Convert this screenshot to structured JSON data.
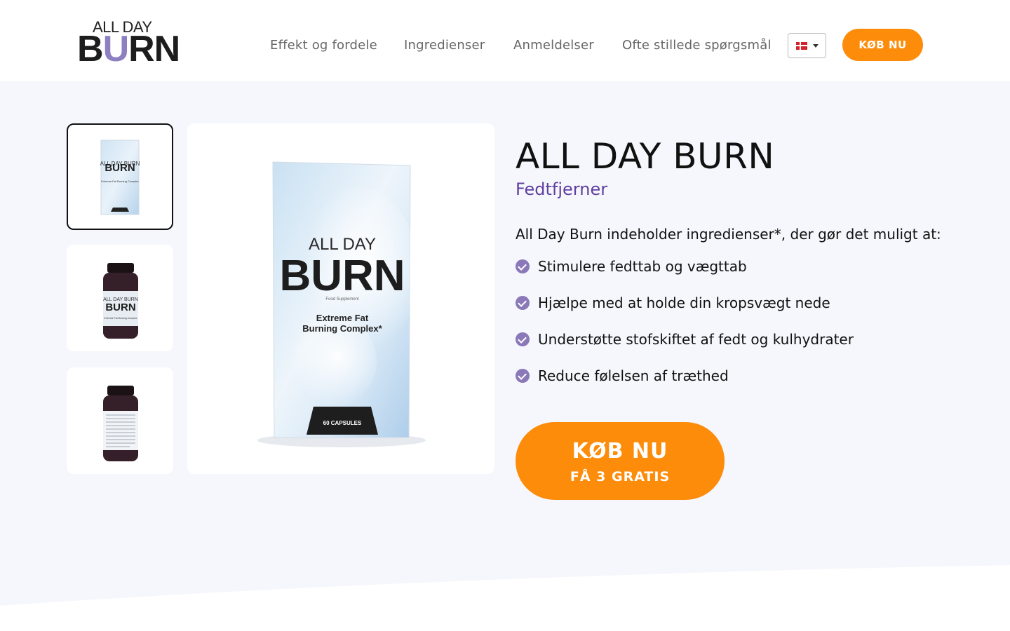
{
  "header": {
    "logo": {
      "top_text": "ALL DAY",
      "main_text_a": "B",
      "main_text_u": "U",
      "main_text_b": "RN"
    },
    "nav": [
      {
        "label": "Effekt og fordele"
      },
      {
        "label": "Ingredienser"
      },
      {
        "label": "Anmeldelser"
      },
      {
        "label": "Ofte stillede spørgsmål"
      }
    ],
    "language": {
      "flag": "denmark-flag-icon",
      "selected": "DK"
    },
    "buy_label": "KØB NU"
  },
  "gallery": {
    "thumbnails": [
      {
        "name": "product-box-thumbnail",
        "label": "ALL DAY BURN",
        "subtext": "Extreme Fat Burning Complex",
        "active": true
      },
      {
        "name": "product-bottle-front-thumbnail",
        "label": "ALL DAY BURN",
        "subtext": "Extreme Fat Burning Complex",
        "active": false
      },
      {
        "name": "product-bottle-back-thumbnail",
        "active": false
      }
    ],
    "main_image": {
      "brand_top": "ALL DAY",
      "brand_main": "BURN",
      "supplement": "Food Supplement",
      "line1": "Extreme Fat",
      "line2": "Burning Complex*",
      "capsules": "60 CAPSULES"
    }
  },
  "product": {
    "title": "ALL DAY BURN",
    "subtitle": "Fedtfjerner",
    "intro": "All Day Burn indeholder ingredienser*, der gør det muligt at:",
    "features": [
      "Stimulere fedttab og vægttab",
      "Hjælpe med at holde din kropsvægt nede",
      "Understøtte stofskiftet af fedt og kulhydrater",
      "Reduce følelsen af træthed"
    ],
    "cta": {
      "line1": "KØB NU",
      "line2": "FÅ 3 GRATIS"
    }
  },
  "colors": {
    "accent": "#fd8c0a",
    "subtitle": "#5f3fa0",
    "check": "#8a78b8",
    "hero_bg": "#f6f7fc"
  }
}
